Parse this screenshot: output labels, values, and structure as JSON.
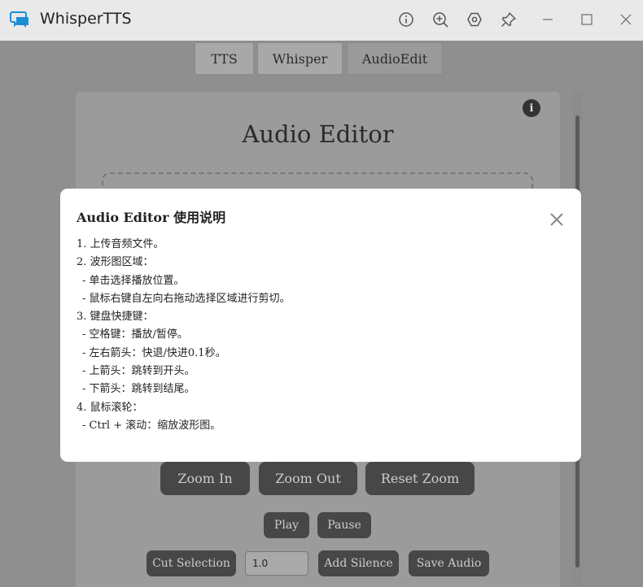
{
  "window": {
    "title": "WhisperTTS",
    "controls": [
      "info-icon",
      "zoom-in-icon",
      "settings-icon",
      "pin-icon",
      "minimize-icon",
      "maximize-icon",
      "close-icon"
    ]
  },
  "tabs": [
    {
      "label": "TTS"
    },
    {
      "label": "Whisper"
    },
    {
      "label": "AudioEdit",
      "active": true
    }
  ],
  "editor": {
    "title": "Audio Editor",
    "info_label": "i",
    "zoom_in": "Zoom In",
    "zoom_out": "Zoom Out",
    "reset_zoom": "Reset Zoom",
    "play": "Play",
    "pause": "Pause",
    "cut_selection": "Cut Selection",
    "silence_value": "1.0",
    "add_silence": "Add Silence",
    "save_audio": "Save Audio"
  },
  "modal": {
    "title": "Audio Editor 使用说明",
    "lines": [
      "1. 上传音频文件。",
      "2. 波形图区域：",
      "  - 单击选择播放位置。",
      "  - 鼠标右键自左向右拖动选择区域进行剪切。",
      "3. 键盘快捷键：",
      "  - 空格键：播放/暂停。",
      "  - 左右箭头：快退/快进0.1秒。",
      "  - 上箭头：跳转到开头。",
      "  - 下箭头：跳转到结尾。",
      "4. 鼠标滚轮：",
      "  - Ctrl + 滚动：缩放波形图。"
    ]
  },
  "colors": {
    "accent": "#1a8fd8",
    "overlay": "#8f8f8f",
    "button": "#474747"
  }
}
